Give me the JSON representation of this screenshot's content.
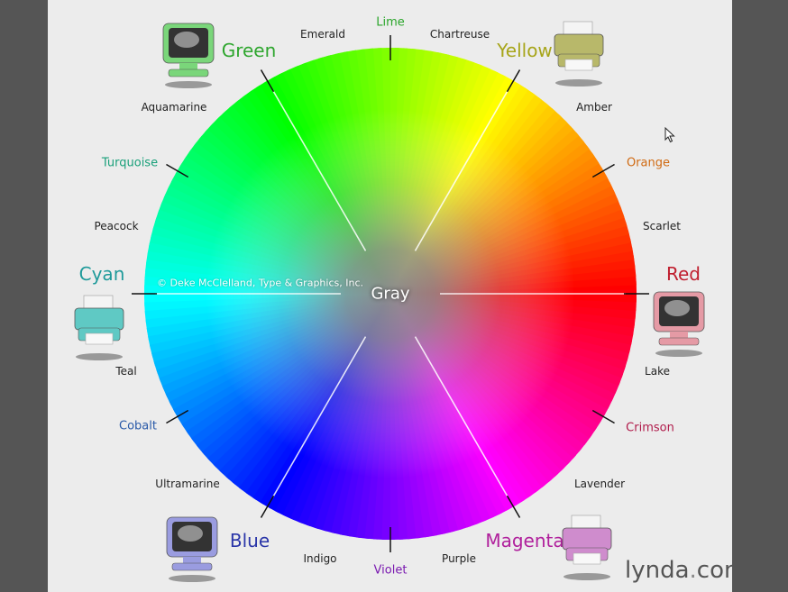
{
  "center_label": "Gray",
  "copyright": "© Deke McClelland, Type & Graphics, Inc.",
  "brand": {
    "name": "lynda",
    "suffix": "com"
  },
  "primaries": [
    {
      "key": "green",
      "text": "Green",
      "color": "#2ea62e",
      "device": "monitor"
    },
    {
      "key": "yellow",
      "text": "Yellow",
      "color": "#a7a51a",
      "device": "printer"
    },
    {
      "key": "red",
      "text": "Red",
      "color": "#c01f2f",
      "device": "monitor"
    },
    {
      "key": "magenta",
      "text": "Magenta",
      "color": "#b0209c",
      "device": "printer"
    },
    {
      "key": "blue",
      "text": "Blue",
      "color": "#2a35a8",
      "device": "monitor"
    },
    {
      "key": "cyan",
      "text": "Cyan",
      "color": "#1e9a9a",
      "device": "printer"
    }
  ],
  "secondaries": [
    {
      "key": "lime",
      "text": "Lime",
      "color": "#2aa52a"
    },
    {
      "key": "orange",
      "text": "Orange",
      "color": "#d06a12"
    },
    {
      "key": "crimson",
      "text": "Crimson",
      "color": "#b01a4a"
    },
    {
      "key": "violet",
      "text": "Violet",
      "color": "#7a1ab0"
    },
    {
      "key": "cobalt",
      "text": "Cobalt",
      "color": "#2a5aa8"
    },
    {
      "key": "turquoise",
      "text": "Turquoise",
      "color": "#1aa07a"
    }
  ],
  "tertiaries": [
    {
      "key": "emerald",
      "text": "Emerald"
    },
    {
      "key": "chartreuse",
      "text": "Chartreuse"
    },
    {
      "key": "amber",
      "text": "Amber"
    },
    {
      "key": "scarlet",
      "text": "Scarlet"
    },
    {
      "key": "lake",
      "text": "Lake"
    },
    {
      "key": "lavender",
      "text": "Lavender"
    },
    {
      "key": "purple",
      "text": "Purple"
    },
    {
      "key": "indigo",
      "text": "Indigo"
    },
    {
      "key": "ultramarine",
      "text": "Ultramarine"
    },
    {
      "key": "teal",
      "text": "Teal"
    },
    {
      "key": "peacock",
      "text": "Peacock"
    },
    {
      "key": "aquamarine",
      "text": "Aquamarine"
    }
  ]
}
